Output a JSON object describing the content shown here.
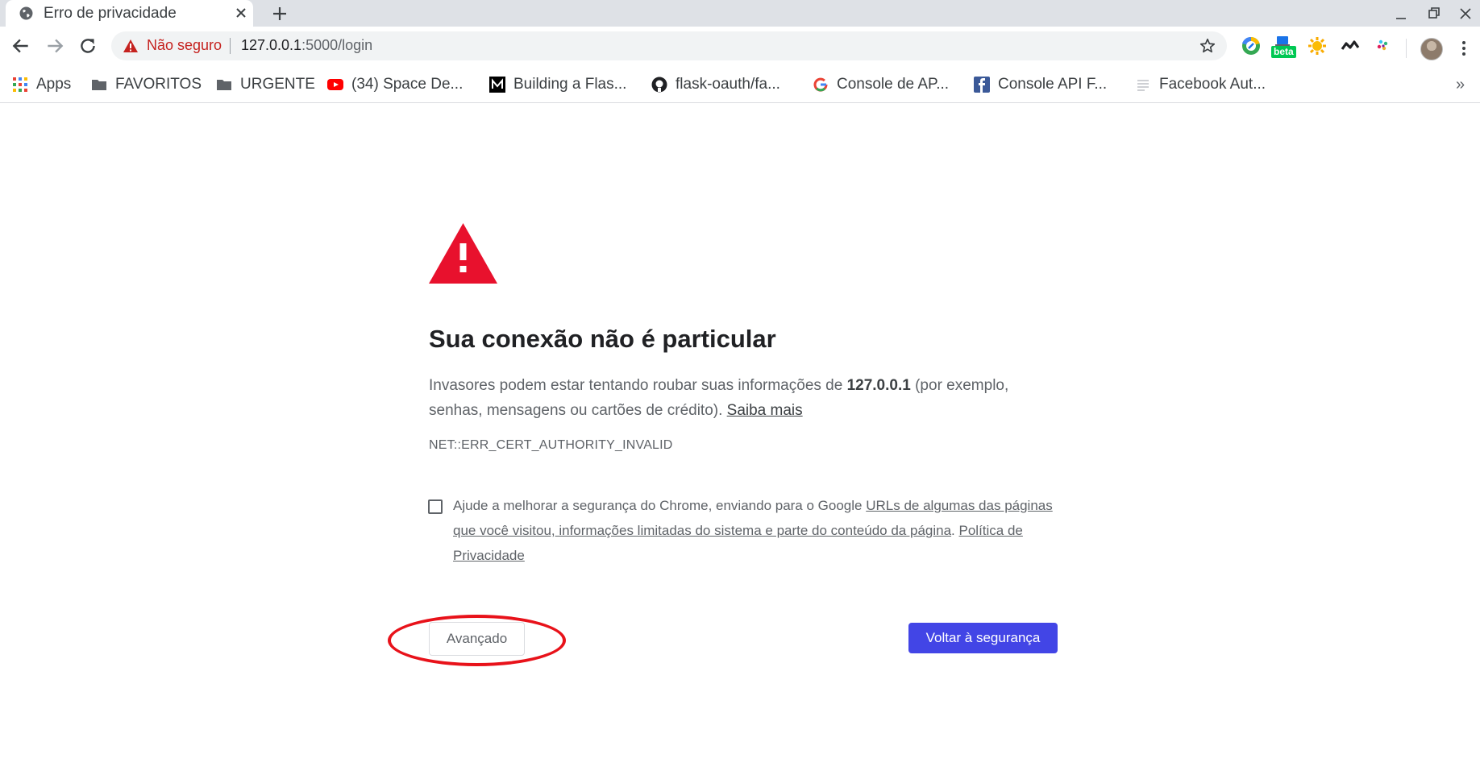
{
  "tab": {
    "title": "Erro de privacidade"
  },
  "address_bar": {
    "security_label": "Não seguro",
    "url_host": "127.0.0.1",
    "url_path": ":5000/login"
  },
  "extensions": {
    "beta_badge": "beta"
  },
  "bookmarks": [
    {
      "label": "Apps",
      "icon": "apps-grid-icon"
    },
    {
      "label": "FAVORITOS",
      "icon": "folder-icon"
    },
    {
      "label": "URGENTE",
      "icon": "folder-icon"
    },
    {
      "label": "(34) Space De...",
      "icon": "youtube-icon"
    },
    {
      "label": "Building a Flas...",
      "icon": "medium-icon"
    },
    {
      "label": "flask-oauth/fa...",
      "icon": "github-icon"
    },
    {
      "label": "Console de AP...",
      "icon": "google-icon"
    },
    {
      "label": "Console API F...",
      "icon": "facebook-icon"
    },
    {
      "label": "Facebook Aut...",
      "icon": "page-icon"
    }
  ],
  "bookmarks_more": "»",
  "interstitial": {
    "heading": "Sua conexão não é particular",
    "para_prefix": "Invasores podem estar tentando roubar suas informações de ",
    "para_host": "127.0.0.1",
    "para_suffix": " (por exemplo, senhas, mensagens ou cartões de crédito). ",
    "learn_more": "Saiba mais",
    "error_code": "NET::ERR_CERT_AUTHORITY_INVALID",
    "optin_prefix": "Ajude a melhorar a segurança do Chrome, enviando para o Google ",
    "optin_link": "URLs de algumas das páginas que você visitou, informações limitadas do sistema e parte do conteúdo da página",
    "optin_mid": ". ",
    "privacy_link": "Política de Privacidade",
    "advanced_button": "Avançado",
    "back_button": "Voltar à segurança"
  },
  "colors": {
    "warning_red": "#e8112d",
    "primary_button": "#4245e6",
    "annotation_ring": "#e8121a"
  }
}
